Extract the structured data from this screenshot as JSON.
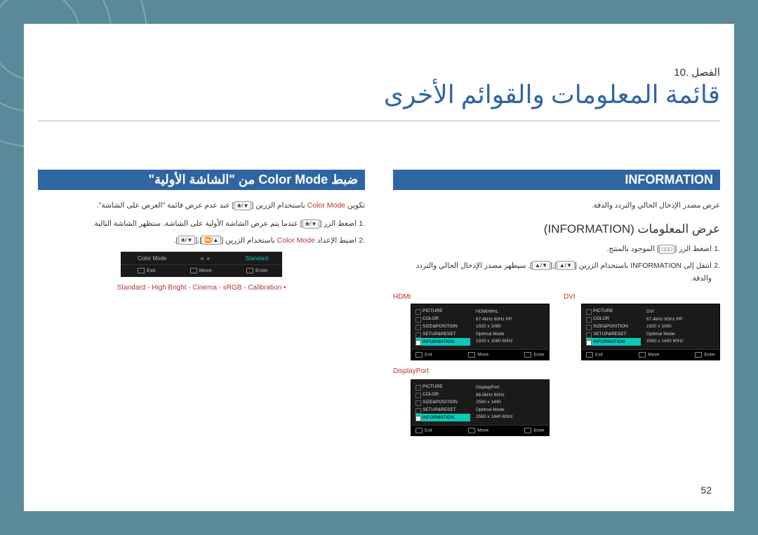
{
  "chapter": "الفصل .10",
  "title": "قائمة المعلومات والقوائم الأخرى",
  "page_number": "52",
  "right_col": {
    "bar": "INFORMATION",
    "intro": "عرض مصدر الإدخال الحالي والتردد والدقة.",
    "subhead": "عرض المعلومات (INFORMATION)",
    "step1_num": ".1",
    "step1_a": "اضغط الزر [",
    "step1_key": "□□□",
    "step1_b": "] الموجود بالمنتج.",
    "step2_num": ".2",
    "step2_a": "انتقل إلى ",
    "step2_inf": "INFORMATION",
    "step2_b": " باستخدام الزرين [",
    "step2_k1": "▲/▼",
    "step2_c": "],[",
    "step2_k2": "▲/▼",
    "step2_d": "]. سيظهر مصدر الإدخال الحالي والتردد والدقة."
  },
  "left_col": {
    "bar": "ضبط Color Mode من \"الشاشة الأولية\"",
    "line1_a": "تكوين ",
    "line1_cm": "Color Mode",
    "line1_b": " باستخدام الزرين [",
    "line1_key": "❀/▼",
    "line1_c": "] عند عدم عرض قائمة \"العرض على الشاشة\".",
    "s1_num": ".1",
    "s1_a": "اضغط الزر [",
    "s1_key": "❀/▼",
    "s1_b": "] عندما يتم عرض الشاشة الأولية على الشاشة. ستظهر الشاشة التالية.",
    "s2_num": ".2",
    "s2_a": "اضبط الإعداد ",
    "s2_cm": "Color Mode",
    "s2_b": " باستخدام الزرين [",
    "s2_k1": "⏩/▲",
    "s2_c": "],[",
    "s2_k2": "❀/▼",
    "s2_d": "].",
    "modes": "Standard - High Bright - Cinema - sRGB - Calibration  •"
  },
  "osd_labels": {
    "dvi": "DVI",
    "hdmi": "HDMI",
    "displayport": "DisplayPort"
  },
  "osd_menu": {
    "items": [
      "PICTURE",
      "COLOR",
      "SIZE&POSITION",
      "SETUP&RESET",
      "INFORMATION"
    ],
    "bar_exit": "Exit",
    "bar_move": "Move",
    "bar_enter": "Enter"
  },
  "osd_info": {
    "dvi": [
      "DVI",
      "67.4kHz  60Hz PP",
      "1920 x 1080",
      "",
      "Optimal Mode",
      "2560 x 1440  60Hz"
    ],
    "hdmi": [
      "HDMI/MHL",
      "67.4kHz  60Hz PP",
      "1920 x 1080",
      "",
      "Optimal Mode",
      "1920 x 1080  60Hz"
    ],
    "displayport": [
      "DisplayPort",
      "88.9kHz  60Hz",
      "2560 x 1440",
      "",
      "Optimal Mode",
      "2560 x 1440  60Hz"
    ]
  },
  "osd_cm": {
    "label": "Color Mode",
    "value": "Standard",
    "exit": "Exit",
    "move": "Move",
    "enter": "Enter"
  }
}
